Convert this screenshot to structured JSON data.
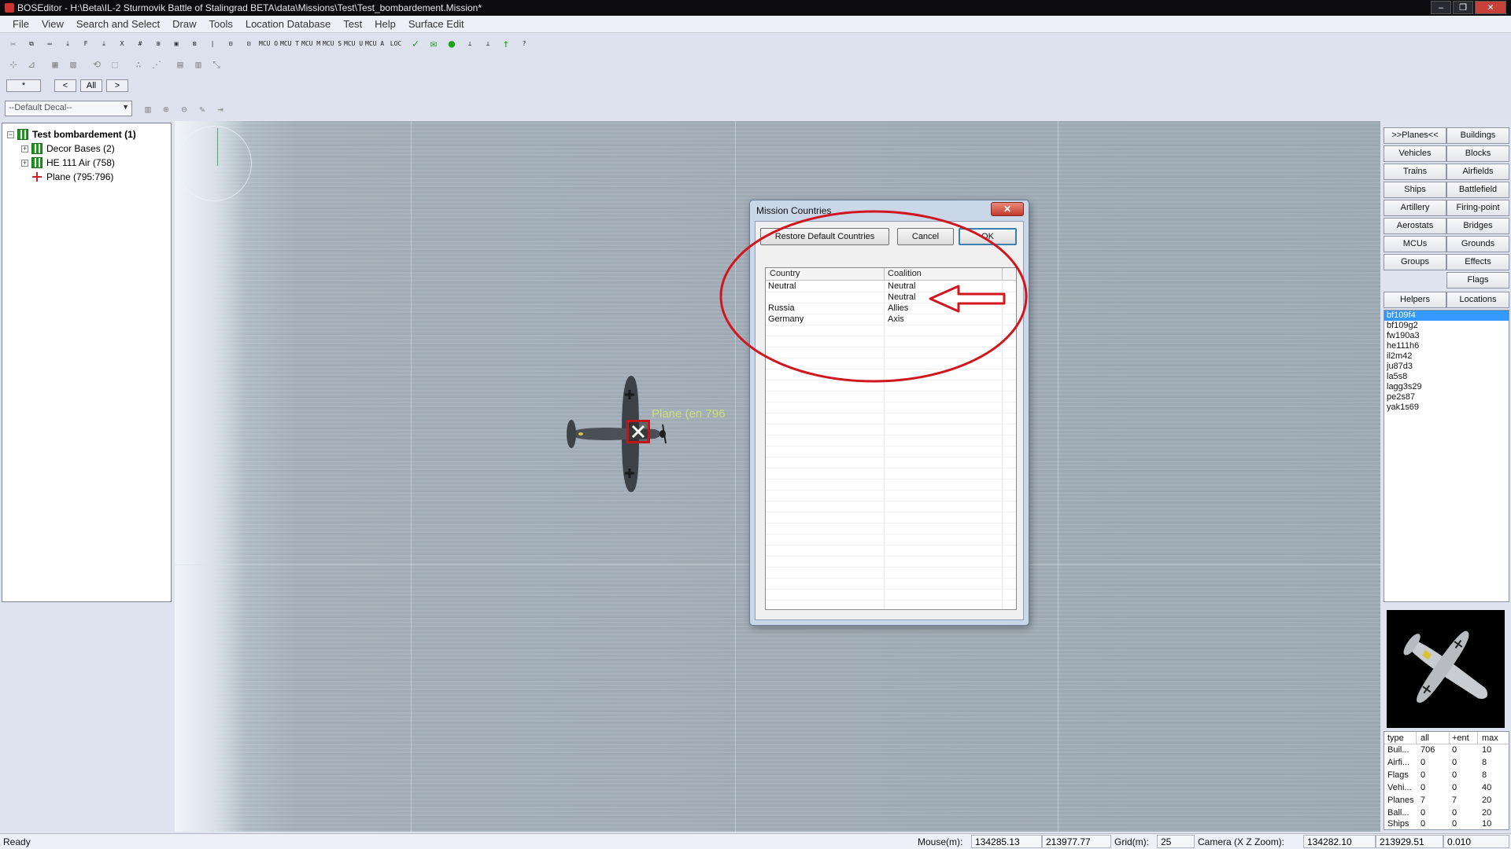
{
  "window": {
    "title": "BOSEditor - H:\\Beta\\IL-2 Sturmovik Battle of Stalingrad BETA\\data\\Missions\\Test\\Test_bombardement.Mission*"
  },
  "menu": {
    "items": [
      "File",
      "View",
      "Search and Select",
      "Draw",
      "Tools",
      "Location Database",
      "Test",
      "Help",
      "Surface Edit"
    ]
  },
  "toolbar": {
    "row1": [
      "✂",
      "⧉",
      "▭",
      "⤓",
      "F",
      "⤓",
      "Ⅹ",
      "#",
      "⊞",
      "▣",
      "⊠",
      "|",
      "⊟",
      "⊡",
      "MCU OBJ",
      "MCU TAR",
      "MCU MES",
      "MCU SEL",
      "MCU UNSI",
      "MCU ARIV",
      "LOC",
      "✓",
      "✉",
      "●",
      "⊥",
      "⊥",
      "↑",
      "?"
    ],
    "row2": [
      "⊹",
      "⊿",
      "▦",
      "▧",
      "⟲",
      "⬚",
      "∴",
      "⋰",
      "▤",
      "▥",
      "⤡"
    ],
    "row3": [
      "*",
      "<",
      "All",
      ">"
    ],
    "decal_select": "--Default Decal--",
    "row4": [
      "▥",
      "⊕",
      "⊖",
      "✎",
      "⇥"
    ]
  },
  "tree": {
    "root": "Test bombardement (1)",
    "children": [
      {
        "label": "Decor Bases (2)"
      },
      {
        "label": "HE 111 Air (758)"
      },
      {
        "label": "Plane (795:796)"
      }
    ]
  },
  "map": {
    "plane_label": "Plane (en  796"
  },
  "dialog": {
    "title": "Mission Countries",
    "close_glyph": "✕",
    "buttons": {
      "restore": "Restore Default Countries",
      "cancel": "Cancel",
      "ok": "OK"
    },
    "columns": [
      "Country",
      "Coalition"
    ],
    "rows": [
      {
        "country": "Neutral",
        "coalition": "Neutral"
      },
      {
        "country": "",
        "coalition": "Neutral"
      },
      {
        "country": "Russia",
        "coalition": "Allies"
      },
      {
        "country": "Germany",
        "coalition": "Axis"
      }
    ]
  },
  "annotation": {
    "color": "#d0161e"
  },
  "right_panel": {
    "categories": [
      [
        ">>Planes<<",
        "Buildings"
      ],
      [
        "Vehicles",
        "Blocks"
      ],
      [
        "Trains",
        "Airfields"
      ],
      [
        "Ships",
        "Battlefield"
      ],
      [
        "Artillery",
        "Firing-point"
      ],
      [
        "Aerostats",
        "Bridges"
      ],
      [
        "MCUs",
        "Grounds"
      ],
      [
        "Groups",
        "Effects"
      ],
      [
        "",
        "Flags"
      ],
      [
        "Helpers",
        "Locations"
      ]
    ],
    "planes": [
      "bf109f4",
      "bf109g2",
      "fw190a3",
      "he111h6",
      "il2m42",
      "ju87d3",
      "la5s8",
      "lagg3s29",
      "pe2s87",
      "yak1s69"
    ],
    "stats": {
      "headers": [
        "type",
        "all",
        "+ent",
        "max"
      ],
      "rows": [
        [
          "Buil...",
          "706",
          "0",
          "10"
        ],
        [
          "Airfi...",
          "0",
          "0",
          "8"
        ],
        [
          "Flags",
          "0",
          "0",
          "8"
        ],
        [
          "Vehi...",
          "0",
          "0",
          "40"
        ],
        [
          "Planes",
          "7",
          "7",
          "20"
        ],
        [
          "Ball...",
          "0",
          "0",
          "20"
        ],
        [
          "Ships",
          "0",
          "0",
          "10"
        ]
      ]
    }
  },
  "status": {
    "ready": "Ready",
    "mouse_label": "Mouse(m):",
    "mouse_x": "134285.13",
    "mouse_z": "213977.77",
    "grid_label": "Grid(m):",
    "grid_value": "25",
    "camera_label": "Camera (X Z Zoom):",
    "camera_x": "134282.10",
    "camera_z": "213929.51",
    "camera_zoom": "0.010"
  }
}
